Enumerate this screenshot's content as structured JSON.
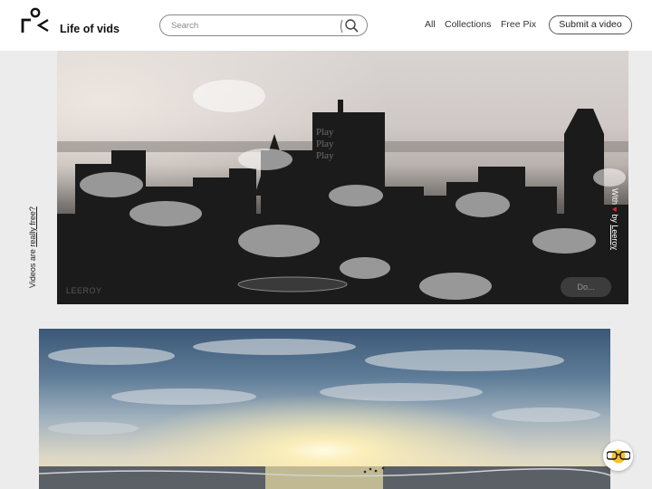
{
  "header": {
    "brand": "Life of vids",
    "search": {
      "placeholder": "Search"
    },
    "nav": {
      "all": "All",
      "collections": "Collections",
      "free_pix": "Free Pix"
    },
    "submit_label": "Submit a video"
  },
  "sidebar": {
    "prefix": "Videos are ",
    "link": "really free?"
  },
  "videos": [
    {
      "play_lines": [
        "Play",
        "Play",
        "Play"
      ],
      "credit": "LEEROY",
      "download_label": "Do...",
      "made_with_prefix": "With ",
      "made_with_suffix": " by",
      "made_with_link": "Leeroy"
    },
    {}
  ],
  "colors": {
    "accent": "#e0262e",
    "header_bg": "#ffffff",
    "page_bg": "#ececec"
  }
}
